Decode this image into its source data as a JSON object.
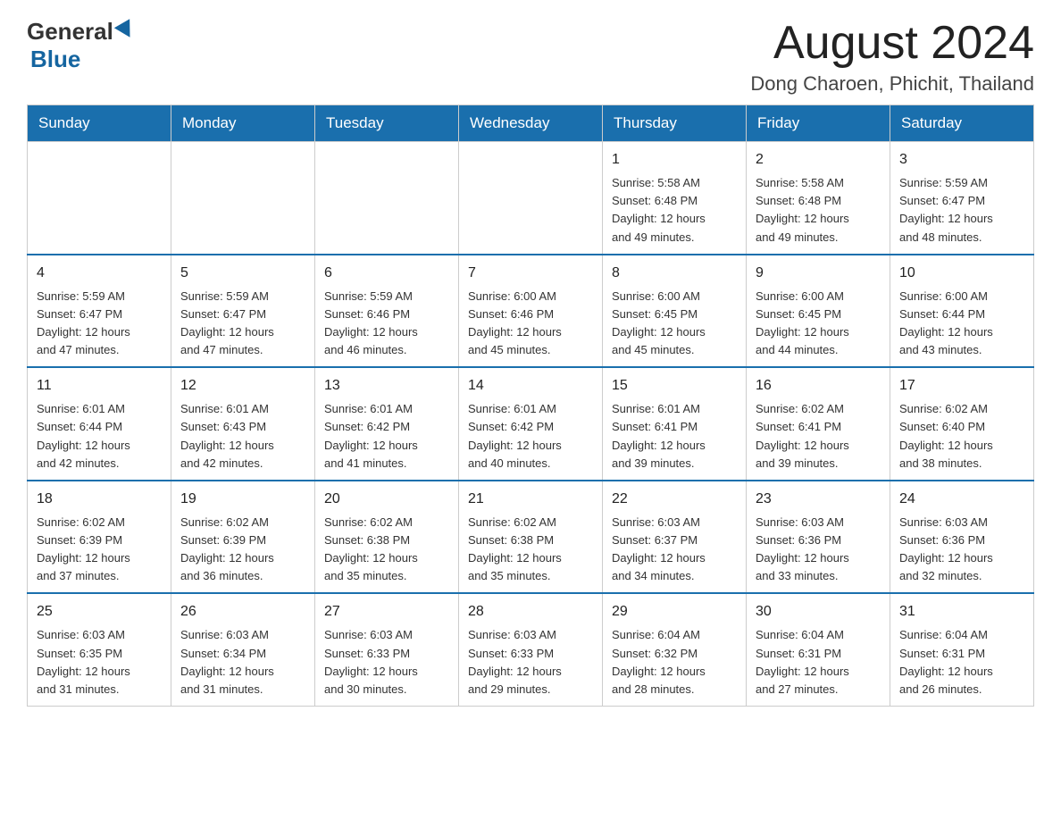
{
  "logo": {
    "general": "General",
    "blue": "Blue"
  },
  "header": {
    "month": "August 2024",
    "location": "Dong Charoen, Phichit, Thailand"
  },
  "days_of_week": [
    "Sunday",
    "Monday",
    "Tuesday",
    "Wednesday",
    "Thursday",
    "Friday",
    "Saturday"
  ],
  "weeks": [
    [
      {
        "day": "",
        "info": ""
      },
      {
        "day": "",
        "info": ""
      },
      {
        "day": "",
        "info": ""
      },
      {
        "day": "",
        "info": ""
      },
      {
        "day": "1",
        "info": "Sunrise: 5:58 AM\nSunset: 6:48 PM\nDaylight: 12 hours\nand 49 minutes."
      },
      {
        "day": "2",
        "info": "Sunrise: 5:58 AM\nSunset: 6:48 PM\nDaylight: 12 hours\nand 49 minutes."
      },
      {
        "day": "3",
        "info": "Sunrise: 5:59 AM\nSunset: 6:47 PM\nDaylight: 12 hours\nand 48 minutes."
      }
    ],
    [
      {
        "day": "4",
        "info": "Sunrise: 5:59 AM\nSunset: 6:47 PM\nDaylight: 12 hours\nand 47 minutes."
      },
      {
        "day": "5",
        "info": "Sunrise: 5:59 AM\nSunset: 6:47 PM\nDaylight: 12 hours\nand 47 minutes."
      },
      {
        "day": "6",
        "info": "Sunrise: 5:59 AM\nSunset: 6:46 PM\nDaylight: 12 hours\nand 46 minutes."
      },
      {
        "day": "7",
        "info": "Sunrise: 6:00 AM\nSunset: 6:46 PM\nDaylight: 12 hours\nand 45 minutes."
      },
      {
        "day": "8",
        "info": "Sunrise: 6:00 AM\nSunset: 6:45 PM\nDaylight: 12 hours\nand 45 minutes."
      },
      {
        "day": "9",
        "info": "Sunrise: 6:00 AM\nSunset: 6:45 PM\nDaylight: 12 hours\nand 44 minutes."
      },
      {
        "day": "10",
        "info": "Sunrise: 6:00 AM\nSunset: 6:44 PM\nDaylight: 12 hours\nand 43 minutes."
      }
    ],
    [
      {
        "day": "11",
        "info": "Sunrise: 6:01 AM\nSunset: 6:44 PM\nDaylight: 12 hours\nand 42 minutes."
      },
      {
        "day": "12",
        "info": "Sunrise: 6:01 AM\nSunset: 6:43 PM\nDaylight: 12 hours\nand 42 minutes."
      },
      {
        "day": "13",
        "info": "Sunrise: 6:01 AM\nSunset: 6:42 PM\nDaylight: 12 hours\nand 41 minutes."
      },
      {
        "day": "14",
        "info": "Sunrise: 6:01 AM\nSunset: 6:42 PM\nDaylight: 12 hours\nand 40 minutes."
      },
      {
        "day": "15",
        "info": "Sunrise: 6:01 AM\nSunset: 6:41 PM\nDaylight: 12 hours\nand 39 minutes."
      },
      {
        "day": "16",
        "info": "Sunrise: 6:02 AM\nSunset: 6:41 PM\nDaylight: 12 hours\nand 39 minutes."
      },
      {
        "day": "17",
        "info": "Sunrise: 6:02 AM\nSunset: 6:40 PM\nDaylight: 12 hours\nand 38 minutes."
      }
    ],
    [
      {
        "day": "18",
        "info": "Sunrise: 6:02 AM\nSunset: 6:39 PM\nDaylight: 12 hours\nand 37 minutes."
      },
      {
        "day": "19",
        "info": "Sunrise: 6:02 AM\nSunset: 6:39 PM\nDaylight: 12 hours\nand 36 minutes."
      },
      {
        "day": "20",
        "info": "Sunrise: 6:02 AM\nSunset: 6:38 PM\nDaylight: 12 hours\nand 35 minutes."
      },
      {
        "day": "21",
        "info": "Sunrise: 6:02 AM\nSunset: 6:38 PM\nDaylight: 12 hours\nand 35 minutes."
      },
      {
        "day": "22",
        "info": "Sunrise: 6:03 AM\nSunset: 6:37 PM\nDaylight: 12 hours\nand 34 minutes."
      },
      {
        "day": "23",
        "info": "Sunrise: 6:03 AM\nSunset: 6:36 PM\nDaylight: 12 hours\nand 33 minutes."
      },
      {
        "day": "24",
        "info": "Sunrise: 6:03 AM\nSunset: 6:36 PM\nDaylight: 12 hours\nand 32 minutes."
      }
    ],
    [
      {
        "day": "25",
        "info": "Sunrise: 6:03 AM\nSunset: 6:35 PM\nDaylight: 12 hours\nand 31 minutes."
      },
      {
        "day": "26",
        "info": "Sunrise: 6:03 AM\nSunset: 6:34 PM\nDaylight: 12 hours\nand 31 minutes."
      },
      {
        "day": "27",
        "info": "Sunrise: 6:03 AM\nSunset: 6:33 PM\nDaylight: 12 hours\nand 30 minutes."
      },
      {
        "day": "28",
        "info": "Sunrise: 6:03 AM\nSunset: 6:33 PM\nDaylight: 12 hours\nand 29 minutes."
      },
      {
        "day": "29",
        "info": "Sunrise: 6:04 AM\nSunset: 6:32 PM\nDaylight: 12 hours\nand 28 minutes."
      },
      {
        "day": "30",
        "info": "Sunrise: 6:04 AM\nSunset: 6:31 PM\nDaylight: 12 hours\nand 27 minutes."
      },
      {
        "day": "31",
        "info": "Sunrise: 6:04 AM\nSunset: 6:31 PM\nDaylight: 12 hours\nand 26 minutes."
      }
    ]
  ]
}
